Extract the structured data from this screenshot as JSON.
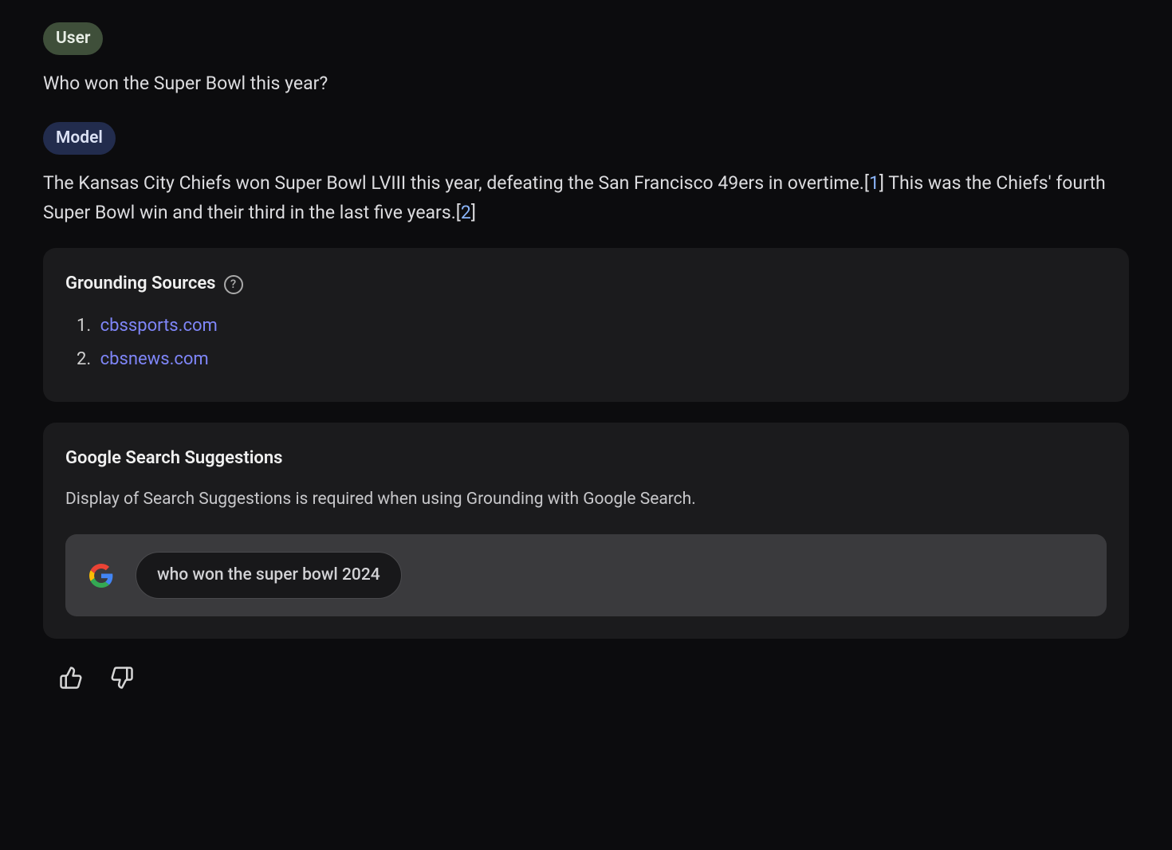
{
  "user": {
    "badge": "User",
    "message": "Who won the Super Bowl this year?"
  },
  "model": {
    "badge": "Model",
    "answer_part1": "The Kansas City Chiefs won Super Bowl LVIII this year, defeating the San Francisco 49ers in overtime.",
    "citation1": "1",
    "answer_part2": " This was the Chiefs' fourth Super Bowl win and their third in the last five years.",
    "citation2": "2"
  },
  "grounding": {
    "title": "Grounding Sources",
    "sources": [
      {
        "num": "1.",
        "domain": "cbssports.com"
      },
      {
        "num": "2.",
        "domain": "cbsnews.com"
      }
    ]
  },
  "suggestions": {
    "title": "Google Search Suggestions",
    "description": "Display of Search Suggestions is required when using Grounding with Google Search.",
    "chip": "who won the super bowl 2024"
  },
  "icons": {
    "help_glyph": "?"
  }
}
